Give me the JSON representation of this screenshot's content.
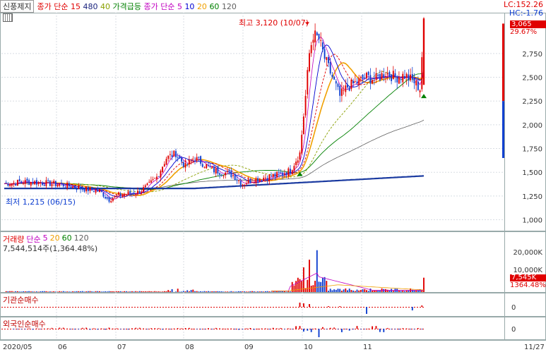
{
  "header": {
    "stock_name": "신풍제지",
    "legend": [
      {
        "name": "종가 단순",
        "color": "#e00000"
      },
      {
        "name": "15",
        "color": "#e00000"
      },
      {
        "name": "480",
        "color": "#1a237e"
      },
      {
        "name": "40",
        "color": "#8aa000"
      },
      {
        "name": "가격급등",
        "color": "#008000"
      },
      {
        "name": "종가 단순",
        "color": "#c000c0"
      },
      {
        "name": "5",
        "color": "#c000c0"
      },
      {
        "name": "10",
        "color": "#0000d0"
      },
      {
        "name": "20",
        "color": "#f0a000"
      },
      {
        "name": "60",
        "color": "#008000"
      },
      {
        "name": "120",
        "color": "#606060"
      }
    ],
    "lc_label": "LC:152.26",
    "hc_label": "HC:-1.76"
  },
  "annotations": {
    "high_label": "최고 3,120 (10/07)",
    "low_label": "최저 1,215 (06/15)",
    "price_tag": "3,065",
    "price_pct": "29.67%"
  },
  "volume_panel": {
    "legend": [
      {
        "name": "거래량",
        "color": "#e00000"
      },
      {
        "name": "단순",
        "color": "#c000c0"
      },
      {
        "name": "5",
        "color": "#c000c0"
      },
      {
        "name": "20",
        "color": "#f0a000"
      },
      {
        "name": "60",
        "color": "#008000"
      },
      {
        "name": "120",
        "color": "#606060"
      }
    ],
    "info": "7,544,514주(1,364.48%)",
    "tag_value": "7,545K",
    "tag_pct": "1364.48%",
    "ticks": [
      "20,000K",
      "10,000K"
    ]
  },
  "institution_panel": {
    "title": "기관순매수",
    "tick": "0"
  },
  "foreign_panel": {
    "title": "외국인순매수",
    "tick": "0"
  },
  "colors": {
    "up": "#e00000",
    "down": "#1040d0",
    "ma5": "#c000c0",
    "ma10": "#0000d0",
    "ma15": "#e00000",
    "ma20": "#f0a000",
    "ma40": "#8aa000",
    "ma60": "#008000",
    "ma120": "#606060",
    "ma480": "#1a3aa0"
  },
  "chart_data": {
    "type": "candlestick",
    "x_labels": [
      "2020/05",
      "06",
      "07",
      "08",
      "09",
      "10",
      "11",
      "11/27"
    ],
    "y_ticks": [
      1000,
      1250,
      1500,
      1750,
      2000,
      2250,
      2500,
      2750
    ],
    "ylim": [
      900,
      3150
    ],
    "high": {
      "value": 3120,
      "date": "10/07"
    },
    "low": {
      "value": 1215,
      "date": "06/15"
    },
    "last_close": 3065,
    "series_close_path": [
      [
        0,
        1380
      ],
      [
        10,
        1400
      ],
      [
        20,
        1390
      ],
      [
        30,
        1370
      ],
      [
        40,
        1330
      ],
      [
        50,
        1300
      ],
      [
        55,
        1215
      ],
      [
        60,
        1260
      ],
      [
        70,
        1290
      ],
      [
        75,
        1350
      ],
      [
        80,
        1450
      ],
      [
        85,
        1650
      ],
      [
        90,
        1700
      ],
      [
        95,
        1560
      ],
      [
        100,
        1650
      ],
      [
        105,
        1580
      ],
      [
        110,
        1520
      ],
      [
        115,
        1500
      ],
      [
        120,
        1470
      ],
      [
        125,
        1380
      ],
      [
        130,
        1420
      ],
      [
        135,
        1440
      ],
      [
        140,
        1460
      ],
      [
        145,
        1480
      ],
      [
        150,
        1520
      ],
      [
        155,
        1700
      ],
      [
        158,
        2300
      ],
      [
        160,
        2750
      ],
      [
        162,
        2950
      ],
      [
        165,
        2900
      ],
      [
        168,
        2700
      ],
      [
        172,
        2500
      ],
      [
        176,
        2300
      ],
      [
        180,
        2400
      ],
      [
        185,
        2450
      ],
      [
        190,
        2500
      ],
      [
        195,
        2480
      ],
      [
        200,
        2550
      ],
      [
        205,
        2500
      ],
      [
        210,
        2520
      ],
      [
        215,
        2450
      ],
      [
        218,
        2380
      ],
      [
        220,
        3065
      ]
    ],
    "volume_ticks_k": [
      20000,
      10000
    ],
    "last_volume_k": 7545
  }
}
